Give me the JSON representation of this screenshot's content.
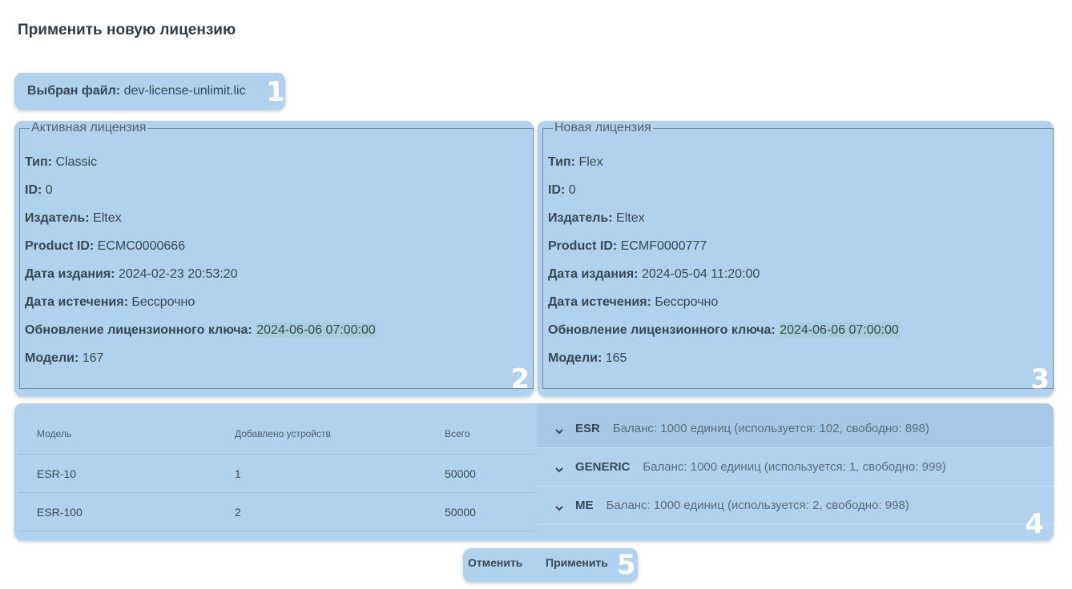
{
  "title": "Применить новую лицензию",
  "file": {
    "label": "Выбран файл:",
    "name": "dev-license-unlimit.lic"
  },
  "active_license": {
    "legend": "Активная лицензия",
    "rows": [
      {
        "label": "Тип:",
        "value": "Classic"
      },
      {
        "label": "ID:",
        "value": "0"
      },
      {
        "label": "Издатель:",
        "value": "Eltex"
      },
      {
        "label": "Product ID:",
        "value": "ECMC0000666"
      },
      {
        "label": "Дата издания:",
        "value": "2024-02-23 20:53:20"
      },
      {
        "label": "Дата истечения:",
        "value": "Бессрочно"
      },
      {
        "label": "Обновление лицензионного ключа:",
        "value": "2024-06-06 07:00:00"
      },
      {
        "label": "Модели:",
        "value": "167"
      }
    ]
  },
  "new_license": {
    "legend": "Новая лицензия",
    "rows": [
      {
        "label": "Тип:",
        "value": "Flex"
      },
      {
        "label": "ID:",
        "value": "0"
      },
      {
        "label": "Издатель:",
        "value": "Eltex"
      },
      {
        "label": "Product ID:",
        "value": "ECMF0000777"
      },
      {
        "label": "Дата издания:",
        "value": "2024-05-04 11:20:00"
      },
      {
        "label": "Дата истечения:",
        "value": "Бессрочно"
      },
      {
        "label": "Обновление лицензионного ключа:",
        "value": "2024-06-06 07:00:00"
      },
      {
        "label": "Модели:",
        "value": "165"
      }
    ]
  },
  "models_table": {
    "columns": [
      "Модель",
      "Добавлено устройств",
      "Всего"
    ],
    "rows": [
      [
        "ESR-10",
        "1",
        "50000"
      ],
      [
        "ESR-100",
        "2",
        "50000"
      ]
    ]
  },
  "balances": [
    {
      "name": "ESR",
      "balance": "Баланс: 1000 единиц (используется: 102, свободно: 898)"
    },
    {
      "name": "GENERIC",
      "balance": "Баланс: 1000 единиц (используется: 1, свободно: 999)"
    },
    {
      "name": "ME",
      "balance": "Баланс: 1000 единиц (используется: 2, свободно: 998)"
    }
  ],
  "actions": {
    "cancel": "Отменить",
    "apply": "Применить"
  },
  "markers": [
    "1",
    "2",
    "3",
    "4",
    "5"
  ],
  "icons": {
    "chevron": "chevron-down-icon"
  }
}
